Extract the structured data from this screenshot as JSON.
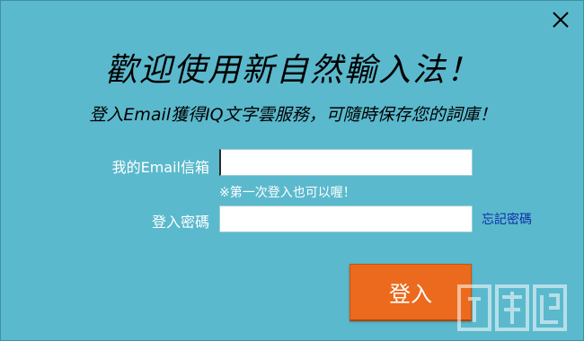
{
  "dialog": {
    "title": "歡迎使用新自然輸入法！",
    "subtitle": "登入Email獲得IQ文字雲服務，可隨時保存您的詞庫！"
  },
  "form": {
    "email_label": "我的Email信箱",
    "email_value": "",
    "hint": "※第一次登入也可以喔！",
    "password_label": "登入密碼",
    "password_value": "",
    "forgot_password": "忘記密碼",
    "login_button": "登入"
  },
  "icons": {
    "close": "close-icon"
  },
  "colors": {
    "background": "#5bb9cd",
    "login_button": "#ec6a1d",
    "link": "#0c2fa8"
  }
}
